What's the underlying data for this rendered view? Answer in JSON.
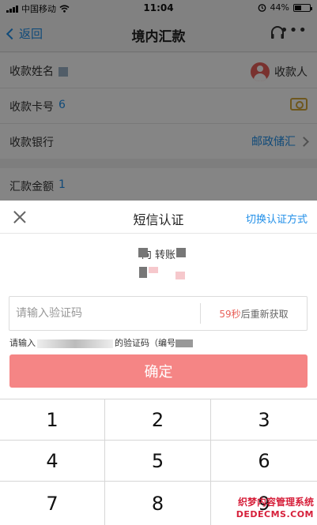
{
  "status_bar": {
    "carrier": "中国移动",
    "time": "11:04",
    "battery": "44%",
    "battery_level": 0.44
  },
  "nav": {
    "back_label": "返回",
    "title": "境内汇款"
  },
  "form": {
    "payee_name_label": "收款姓名",
    "payee_button_label": "收款人",
    "card_label": "收款卡号",
    "card_value": "6",
    "bank_label": "收款银行",
    "bank_value": "邮政储汇",
    "amount_label": "汇款金额",
    "amount_value": "1"
  },
  "sms_dialog": {
    "title": "短信认证",
    "switch_label": "切换认证方式",
    "description": "向                转账",
    "code_placeholder": "请输入验证码",
    "countdown_seconds": "59秒",
    "countdown_suffix": "后重新获取",
    "hint_prefix": "请输入",
    "hint_suffix": "的验证码（编号",
    "confirm_label": "确定"
  },
  "keypad": {
    "keys": [
      "1",
      "2",
      "3",
      "4",
      "5",
      "6",
      "7",
      "8",
      "9"
    ]
  },
  "watermark": {
    "line1": "织梦内容管理系统",
    "line2": "DEDECMS.COM"
  }
}
